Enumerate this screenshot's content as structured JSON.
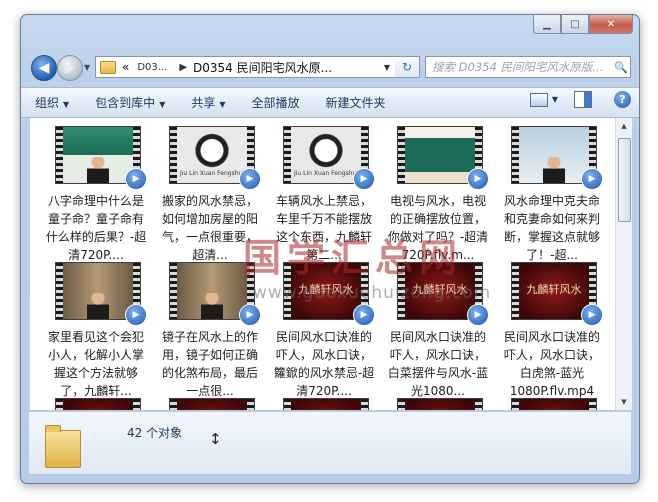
{
  "window": {
    "nav": {
      "back_icon": "back-arrow-icon",
      "forward_icon": "forward-arrow-icon",
      "address": {
        "prefix": "«",
        "crumbs": [
          "D03...",
          "D0354 民间阳宅风水原..."
        ]
      },
      "search_placeholder": "搜索 D0354 民间阳宅风水原版..."
    },
    "toolbar": {
      "organize": "组织",
      "include_in_library": "包含到库中",
      "share": "共享",
      "play_all": "全部播放",
      "new_folder": "新建文件夹"
    },
    "files": [
      {
        "caption": "八字命理中什么是童子命？童子命有什么样的后果？-超清720P....",
        "style": "green"
      },
      {
        "caption": "搬家的风水禁忌，如何增加房屋的阳气，一点很重要，超清...",
        "style": "ink",
        "thumb_text": "Jiu Lin Xuan Fengshui"
      },
      {
        "caption": "车辆风水上禁忌，车里千万不能摆放这个东西，九麟轩第二...",
        "style": "ink",
        "thumb_text": "Jiu Lin Xuan Fengshui"
      },
      {
        "caption": "电视与风水，电视的正确摆放位置，你做对了吗？-超清720P.flv.m...",
        "style": "board"
      },
      {
        "caption": "风水命理中克夫命和克妻命如何来判断，掌握这点就够了！-超...",
        "style": "man"
      },
      {
        "caption": "家里看见这个会犯小人，化解小人掌握这个方法就够了，九麟轩...",
        "style": "studio"
      },
      {
        "caption": "镜子在风水上的作用，镜子如何正确的化煞布局，最后一点很...",
        "style": "studio"
      },
      {
        "caption": "民间风水口诀准的吓人，风水口诀，籮鍁的风水禁忌-超清720P....",
        "style": "red",
        "thumb_text": "九麟轩风水"
      },
      {
        "caption": "民间风水口诀准的吓人，风水口诀，白菜摆件与风水-蓝光1080...",
        "style": "red",
        "thumb_text": "九麟轩风水"
      },
      {
        "caption": "民间风水口诀准的吓人，风水口诀，白虎煞-蓝光1080P.flv.mp4",
        "style": "red",
        "thumb_text": "九麟轩风水"
      },
      {
        "caption": "",
        "style": "red"
      },
      {
        "caption": "",
        "style": "red"
      },
      {
        "caption": "",
        "style": "red"
      },
      {
        "caption": "",
        "style": "red"
      },
      {
        "caption": "",
        "style": "red"
      }
    ],
    "watermark": {
      "cn": "国学汇总网",
      "url": "www.guoxuehuizong.com"
    },
    "details": {
      "item_count": "42 个对象"
    }
  }
}
